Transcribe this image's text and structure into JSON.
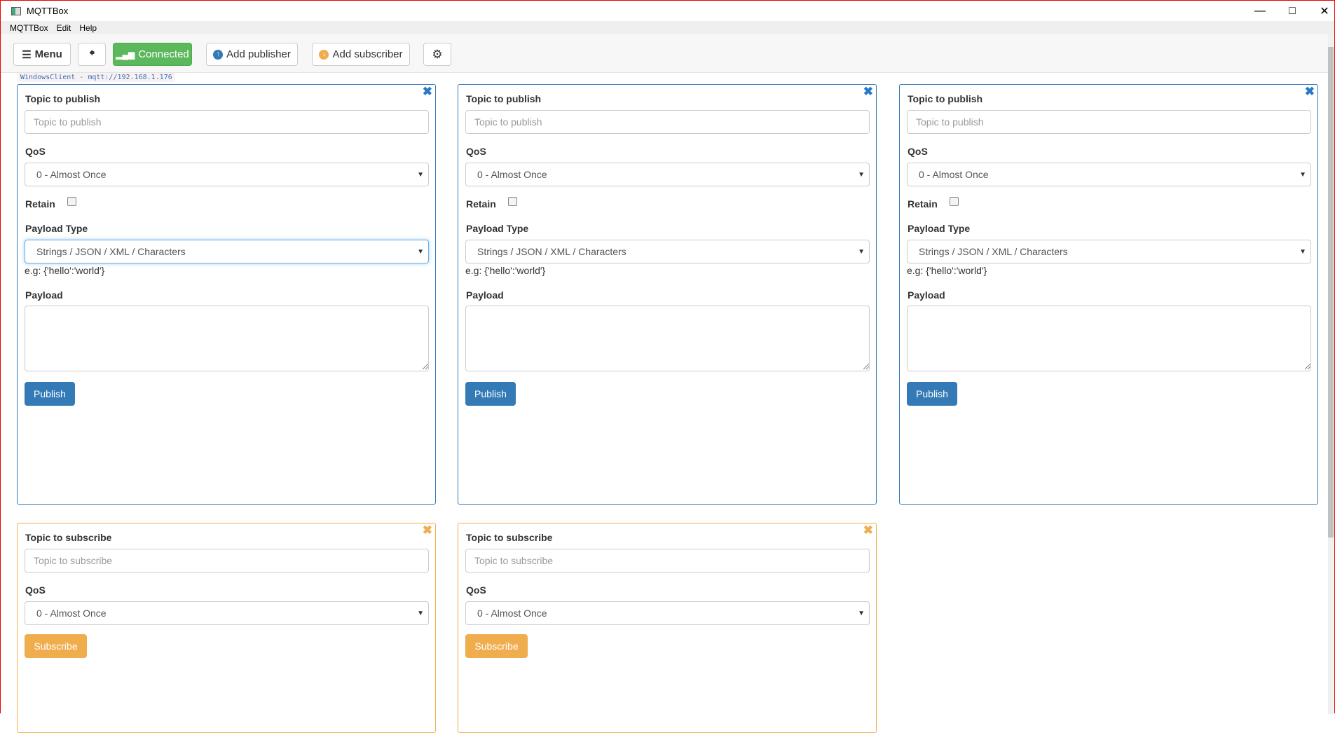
{
  "window": {
    "title": "MQTTBox"
  },
  "menubar": [
    "MQTTBox",
    "Edit",
    "Help"
  ],
  "toolbar": {
    "menu": "Menu",
    "connected": "Connected",
    "add_publisher": "Add publisher",
    "add_subscriber": "Add subscriber"
  },
  "client_label": "WindowsClient - mqtt://192.168.1.176",
  "colors": {
    "primary": "#337ab7",
    "success": "#5cb85c",
    "warning": "#f0ad4e"
  },
  "publishers": [
    {
      "topic_label": "Topic to publish",
      "topic_placeholder": "Topic to publish",
      "qos_label": "QoS",
      "qos": "0 - Almost Once",
      "retain_label": "Retain",
      "retain": false,
      "payload_type_label": "Payload Type",
      "payload_type": "Strings / JSON / XML / Characters",
      "hint": "e.g: {'hello':'world'}",
      "payload_label": "Payload",
      "payload": "",
      "button": "Publish"
    },
    {
      "topic_label": "Topic to publish",
      "topic_placeholder": "Topic to publish",
      "qos_label": "QoS",
      "qos": "0 - Almost Once",
      "retain_label": "Retain",
      "retain": false,
      "payload_type_label": "Payload Type",
      "payload_type": "Strings / JSON / XML / Characters",
      "hint": "e.g: {'hello':'world'}",
      "payload_label": "Payload",
      "payload": "",
      "button": "Publish"
    },
    {
      "topic_label": "Topic to publish",
      "topic_placeholder": "Topic to publish",
      "qos_label": "QoS",
      "qos": "0 - Almost Once",
      "retain_label": "Retain",
      "retain": false,
      "payload_type_label": "Payload Type",
      "payload_type": "Strings / JSON / XML / Characters",
      "hint": "e.g: {'hello':'world'}",
      "payload_label": "Payload",
      "payload": "",
      "button": "Publish"
    }
  ],
  "subscribers": [
    {
      "topic_label": "Topic to subscribe",
      "topic_placeholder": "Topic to subscribe",
      "qos_label": "QoS",
      "qos": "0 - Almost Once",
      "button": "Subscribe"
    },
    {
      "topic_label": "Topic to subscribe",
      "topic_placeholder": "Topic to subscribe",
      "qos_label": "QoS",
      "qos": "0 - Almost Once",
      "button": "Subscribe"
    }
  ]
}
